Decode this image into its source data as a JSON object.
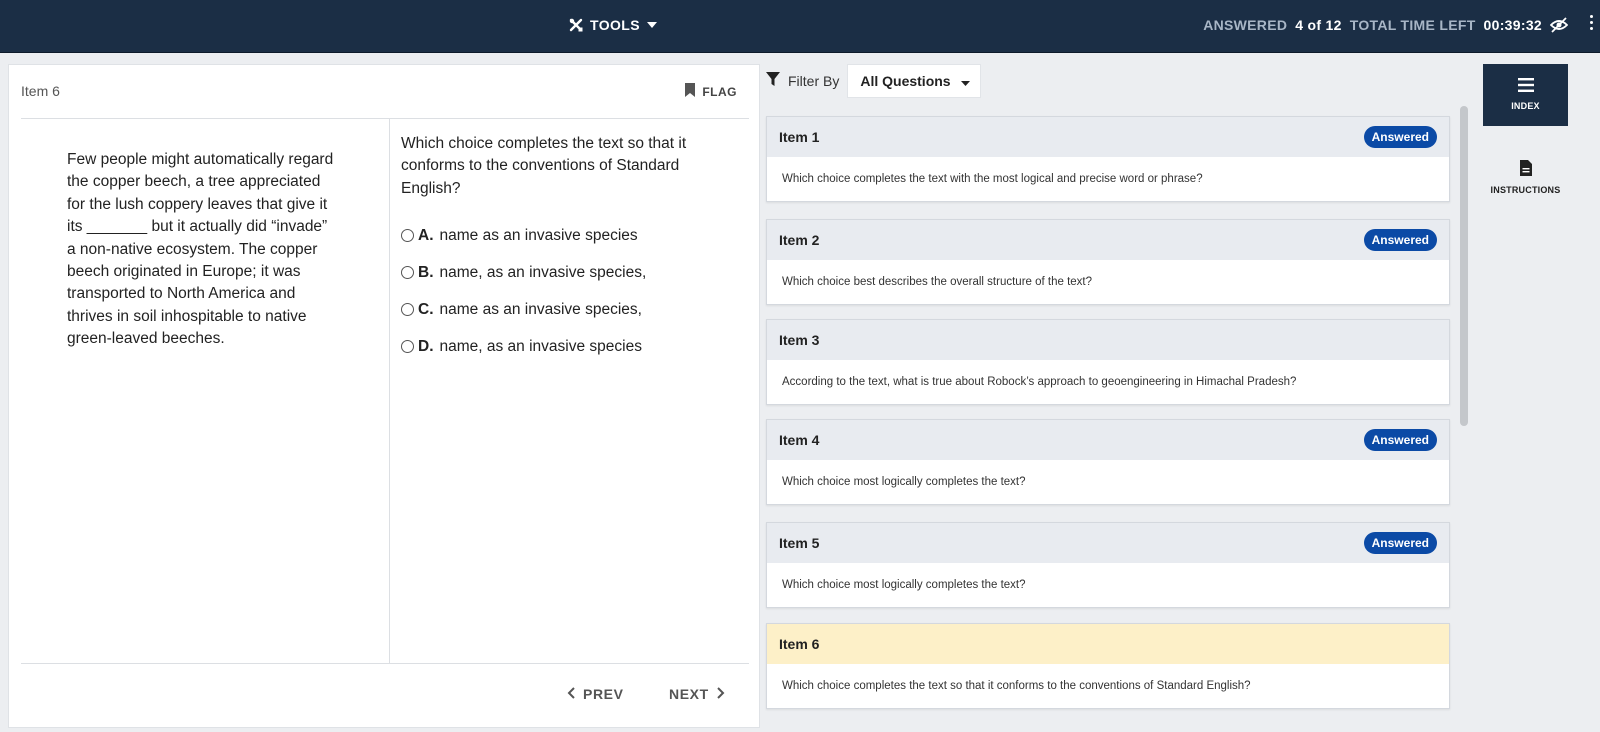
{
  "header": {
    "tools_label": "TOOLS",
    "answered_label": "ANSWERED",
    "answered_value": "4 of 12",
    "time_label": "TOTAL TIME LEFT",
    "time_value": "00:39:32"
  },
  "question_panel": {
    "item_label": "Item 6",
    "flag_label": "FLAG",
    "passage": "Few people might automatically regard the copper beech, a tree appreciated for the lush coppery leaves that give it its _______ but it actually did “invade” a non-native ecosystem. The copper beech originated in Europe; it was transported to North America and thrives in soil inhospitable to native green-leaved beeches.",
    "stem": "Which choice completes the text so that it conforms to the conventions of Standard English?",
    "options": [
      {
        "letter": "A.",
        "text": "name as an invasive species"
      },
      {
        "letter": "B.",
        "text": "name, as an invasive species,"
      },
      {
        "letter": "C.",
        "text": "name as an invasive species,"
      },
      {
        "letter": "D.",
        "text": "name, as an invasive species"
      }
    ],
    "prev_label": "PREV",
    "next_label": "NEXT"
  },
  "filter": {
    "label": "Filter By",
    "selected": "All Questions"
  },
  "items": [
    {
      "title": "Item 1",
      "badge": "Answered",
      "text": "Which choice completes the text with the most logical and precise word or phrase?"
    },
    {
      "title": "Item 2",
      "badge": "Answered",
      "text": "Which choice best describes the overall structure of the text?"
    },
    {
      "title": "Item 3",
      "badge": "",
      "text": "According to the text, what is true about Robock’s approach to geoengineering in Himachal Pradesh?"
    },
    {
      "title": "Item 4",
      "badge": "Answered",
      "text": "Which choice most logically completes the text?"
    },
    {
      "title": "Item 5",
      "badge": "Answered",
      "text": "Which choice most logically completes the text?"
    },
    {
      "title": "Item 6",
      "badge": "",
      "text": "Which choice completes the text so that it conforms to the conventions of Standard English?"
    }
  ],
  "rail": {
    "index_label": "INDEX",
    "instructions_label": "INSTRUCTIONS"
  },
  "colors": {
    "topbar": "#1b2e45",
    "badge": "#0b4aa6",
    "current_item": "#fdf0c8"
  }
}
